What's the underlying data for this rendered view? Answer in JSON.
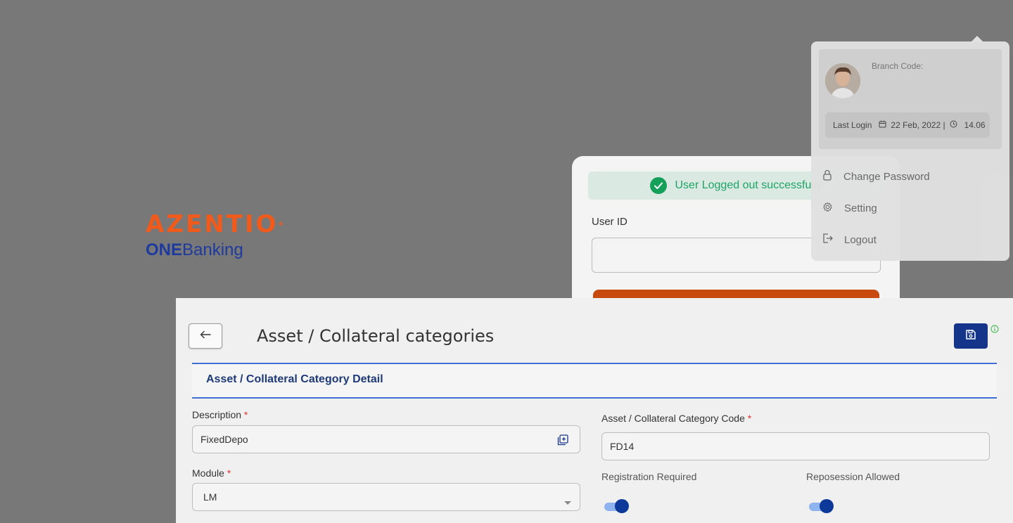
{
  "brand": {
    "name": "AZENTIO",
    "reg": "®",
    "product_bold": "ONE",
    "product_rest": "Banking"
  },
  "login": {
    "alert_text": "User Logged out successfully",
    "user_id_label": "User ID",
    "user_id_value": ""
  },
  "profile": {
    "branch_label": "Branch Code:",
    "last_login_label": "Last Login",
    "last_login_date": "22 Feb, 2022 |",
    "last_login_time": "14.06",
    "menu": [
      {
        "label": "Change Password",
        "icon": "lock-icon"
      },
      {
        "label": "Setting",
        "icon": "gear-icon"
      },
      {
        "label": "Logout",
        "icon": "logout-icon"
      }
    ]
  },
  "form": {
    "page_title": "Asset / Collateral categories",
    "section_title": "Asset / Collateral Category Detail",
    "description_label": "Description",
    "description_value": "FixedDepo",
    "module_label": "Module",
    "module_value": "LM",
    "code_label": "Asset / Collateral Category Code",
    "code_value": "FD14",
    "registration_label": "Registration Required",
    "registration_on": true,
    "repossession_label": "Reposession Allowed",
    "repossession_on": true,
    "required_mark": "*"
  },
  "colors": {
    "accent": "#15358a",
    "brand_orange": "#f05a1a",
    "success": "#15a05a",
    "section_border": "#3d6fd6"
  }
}
